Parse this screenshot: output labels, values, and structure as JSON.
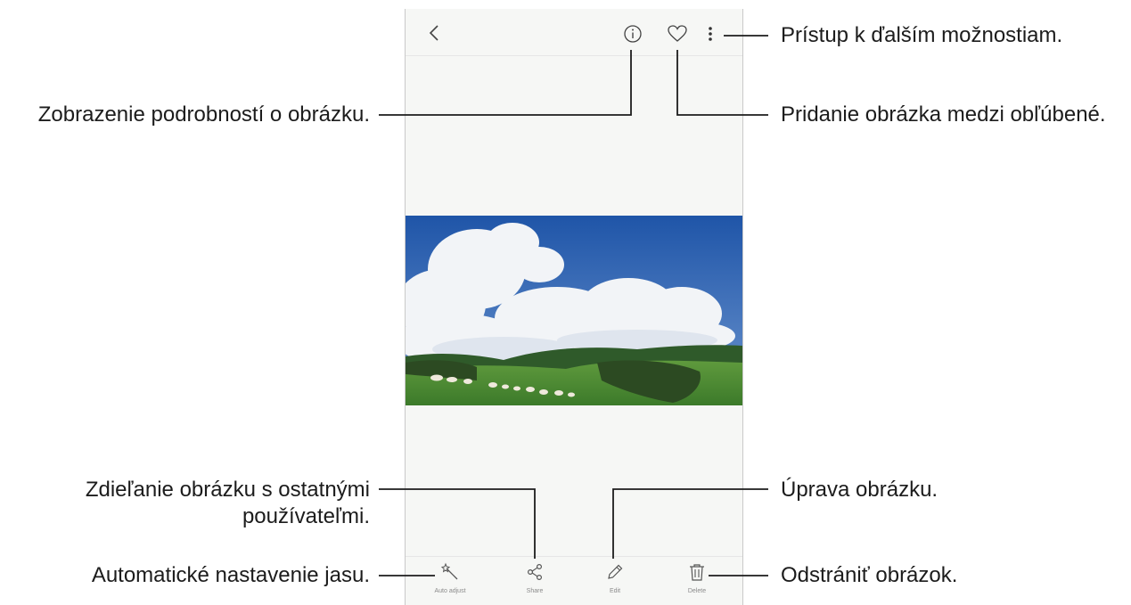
{
  "callouts": {
    "more_options": "Prístup k ďalším možnostiam.",
    "details": "Zobrazenie podrobností o obrázku.",
    "favorite": "Pridanie obrázka medzi obľúbené.",
    "share_line1": "Zdieľanie obrázku s ostatnými",
    "share_line2": "používateľmi.",
    "edit": "Úprava obrázku.",
    "auto_adjust": "Automatické nastavenie jasu.",
    "delete": "Odstrániť obrázok."
  },
  "toolbar": {
    "auto_adjust_label": "Auto adjust",
    "share_label": "Share",
    "edit_label": "Edit",
    "delete_label": "Delete"
  },
  "icons": {
    "back": "chevron-left-icon",
    "info": "info-icon",
    "favorite": "heart-icon",
    "more": "more-vertical-icon",
    "auto_adjust": "magic-wand-icon",
    "share": "share-icon",
    "edit": "pencil-icon",
    "delete": "trash-icon"
  },
  "colors": {
    "leader_line": "#1c1c1c",
    "phone_bg": "#f6f7f5",
    "sky": "#2a63b4",
    "grass": "#4e8a35"
  }
}
